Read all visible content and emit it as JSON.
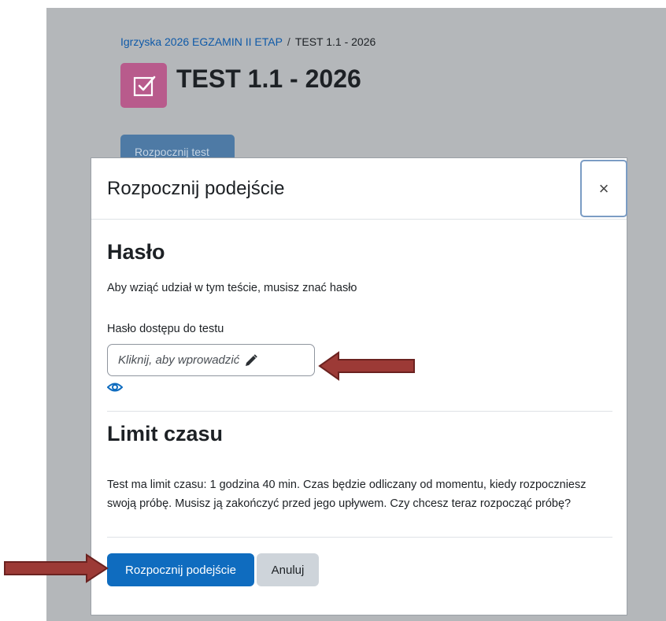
{
  "breadcrumb": {
    "course": "Igrzyska 2026 EGZAMIN II ETAP",
    "separator": "/",
    "current": "TEST 1.1 - 2026"
  },
  "page": {
    "title": "TEST 1.1 - 2026",
    "icon": "quiz-checkbox-icon",
    "start_button_label": "Rozpocznij test"
  },
  "modal": {
    "title": "Rozpocznij podejście",
    "close_label": "×",
    "password_section": {
      "heading": "Hasło",
      "description": "Aby wziąć udział w tym teście, musisz znać hasło",
      "field_label": "Hasło dostępu do testu",
      "field_placeholder": "Kliknij, aby wprowadzić",
      "icons": [
        "pencil-icon",
        "eye-icon"
      ]
    },
    "time_section": {
      "heading": "Limit czasu",
      "text": "Test ma limit czasu: 1 godzina 40 min. Czas będzie odliczany od momentu, kiedy rozpoczniesz swoją próbę. Musisz ją zakończyć przed jego upływem. Czy chcesz teraz rozpocząć próbę?"
    },
    "buttons": {
      "primary": "Rozpocznij podejście",
      "secondary": "Anuluj"
    }
  },
  "annotations": {
    "arrow_color": "#9c3a36"
  },
  "colors": {
    "primary": "#0f6cbf",
    "icon_bg": "#b85b8c",
    "backdrop": "#b4b7ba"
  }
}
